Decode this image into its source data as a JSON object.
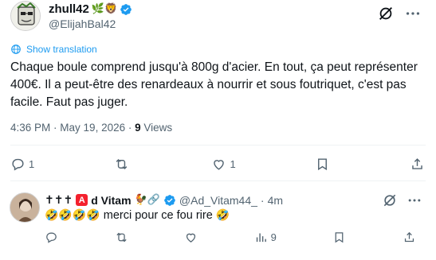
{
  "tweet": {
    "author_name": "zhull42",
    "author_name_emojis": "🌿🦁",
    "author_handle": "@ElijahBal42",
    "show_translation": "Show translation",
    "text": "Chaque boule comprend jusqu'à 800g d'acier. En tout, ça peut représenter 400€. Il a peut-être des renardeaux à nourrir et sous foutriquet, c'est pas facile. Faut pas juger.",
    "time": "4:36 PM",
    "date": "May 19, 2026",
    "views_count": "9",
    "views_label": "Views",
    "actions": {
      "replies": "1",
      "reposts": "",
      "likes": "1"
    }
  },
  "reply": {
    "name_prefix": "✝✝✝",
    "name_letter": "A",
    "name_rest": "d Vitam",
    "name_emojis": "🐓🔗",
    "handle": "@Ad_Vitam44_",
    "dot": "·",
    "age": "4m",
    "emoji_lead": "🤣🤣🤣🤣",
    "text": "merci pour ce fou rire",
    "emoji_trail": "🤣",
    "views": "9"
  },
  "colors": {
    "accent": "#1d9bf0",
    "muted": "#536471",
    "text": "#0f1419",
    "divider": "#eff3f4",
    "name_badge": "#f4212e"
  },
  "icons": [
    "grok-icon",
    "more-icon",
    "verified-badge-icon",
    "globe-icon",
    "reply-icon",
    "repost-icon",
    "like-icon",
    "bookmark-icon",
    "share-icon",
    "views-icon"
  ]
}
